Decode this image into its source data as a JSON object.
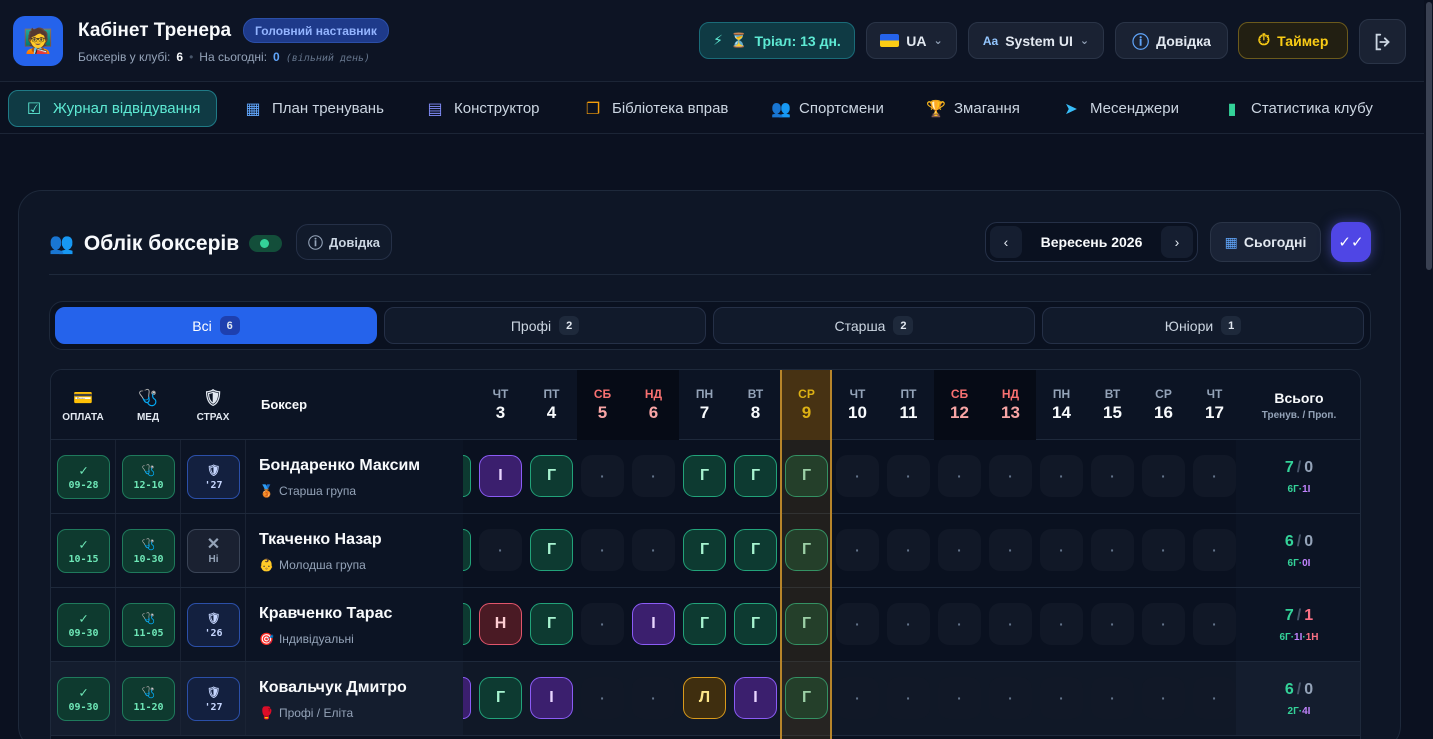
{
  "header": {
    "title": "Кабінет Тренера",
    "role": "Головний наставник",
    "boxers_label": "Боксерів у клубі:",
    "boxers_count": "6",
    "today_label": "На сьогодні:",
    "today_count": "0",
    "day_off": "(вільний день)",
    "trial": "Тріал: 13 дн.",
    "lang": "UA",
    "font": "System UI",
    "help": "Довідка",
    "timer": "Таймер"
  },
  "nav": [
    {
      "label": "Журнал відвідування",
      "icon": "checkbox-icon"
    },
    {
      "label": "План тренувань",
      "icon": "calendar-icon"
    },
    {
      "label": "Конструктор",
      "icon": "layout-icon"
    },
    {
      "label": "Бібліотека вправ",
      "icon": "book-icon"
    },
    {
      "label": "Спортсмени",
      "icon": "users-icon"
    },
    {
      "label": "Змагання",
      "icon": "trophy-icon"
    },
    {
      "label": "Месенджери",
      "icon": "send-icon"
    },
    {
      "label": "Статистика клубу",
      "icon": "bar-chart-icon"
    }
  ],
  "card": {
    "title": "Облік боксерів",
    "help": "Довідка",
    "month": "Вересень 2026",
    "today": "Сьогодні"
  },
  "filters": [
    {
      "label": "Всі",
      "count": "6"
    },
    {
      "label": "Профі",
      "count": "2"
    },
    {
      "label": "Старша",
      "count": "2"
    },
    {
      "label": "Юніори",
      "count": "1"
    }
  ],
  "table": {
    "col_pay": "ОПЛАТА",
    "col_med": "МЕД",
    "col_ins": "СТРАХ",
    "col_boxer": "Боксер",
    "total_title": "Всього",
    "total_sub": "Тренув. / Проп.",
    "days": [
      {
        "dw": "ЧТ",
        "dn": "3"
      },
      {
        "dw": "ПТ",
        "dn": "4"
      },
      {
        "dw": "СБ",
        "dn": "5"
      },
      {
        "dw": "НД",
        "dn": "6"
      },
      {
        "dw": "ПН",
        "dn": "7"
      },
      {
        "dw": "ВТ",
        "dn": "8"
      },
      {
        "dw": "СР",
        "dn": "9"
      },
      {
        "dw": "ЧТ",
        "dn": "10"
      },
      {
        "dw": "ПТ",
        "dn": "11"
      },
      {
        "dw": "СБ",
        "dn": "12"
      },
      {
        "dw": "НД",
        "dn": "13"
      },
      {
        "dw": "ПН",
        "dn": "14"
      },
      {
        "dw": "ВТ",
        "dn": "15"
      },
      {
        "dw": "СР",
        "dn": "16"
      },
      {
        "dw": "ЧТ",
        "dn": "17"
      }
    ],
    "rows": [
      {
        "name": "Бондаренко Максим",
        "group": "Старша група",
        "group_icon": "🥉",
        "pay": "09-28",
        "med": "12-10",
        "ins": "'27",
        "ins_ok": true,
        "cells": [
          "І",
          "Г",
          "·",
          "·",
          "Г",
          "Г",
          "Г",
          "·",
          "·",
          "·",
          "·",
          "·",
          "·",
          "·",
          "·"
        ],
        "edge": "Г",
        "trained": "7",
        "missed": "0",
        "breakdown": "6Г·1І"
      },
      {
        "name": "Ткаченко Назар",
        "group": "Молодша група",
        "group_icon": "👶",
        "pay": "10-15",
        "med": "10-30",
        "ins": "Ні",
        "ins_ok": false,
        "cells": [
          "·",
          "Г",
          "·",
          "·",
          "Г",
          "Г",
          "Г",
          "·",
          "·",
          "·",
          "·",
          "·",
          "·",
          "·",
          "·"
        ],
        "edge": "Г",
        "trained": "6",
        "missed": "0",
        "breakdown": "6Г·0І"
      },
      {
        "name": "Кравченко Тарас",
        "group": "Індивідуальні",
        "group_icon": "🎯",
        "pay": "09-30",
        "med": "11-05",
        "ins": "'26",
        "ins_ok": true,
        "cells": [
          "Н",
          "Г",
          "·",
          "І",
          "Г",
          "Г",
          "Г",
          "·",
          "·",
          "·",
          "·",
          "·",
          "·",
          "·",
          "·"
        ],
        "edge": "Г",
        "trained": "7",
        "missed": "1",
        "breakdown": "6Г·1І·1Н"
      },
      {
        "name": "Ковальчук Дмитро",
        "group": "Профі / Еліта",
        "group_icon": "🥊",
        "pay": "09-30",
        "med": "11-20",
        "ins": "'27",
        "ins_ok": true,
        "cells": [
          "Г",
          "І",
          "·",
          "·",
          "Л",
          "І",
          "Г",
          "·",
          "·",
          "·",
          "·",
          "·",
          "·",
          "·",
          "·"
        ],
        "edge": "І",
        "trained": "6",
        "missed": "0",
        "breakdown": "2Г·4І"
      }
    ]
  }
}
